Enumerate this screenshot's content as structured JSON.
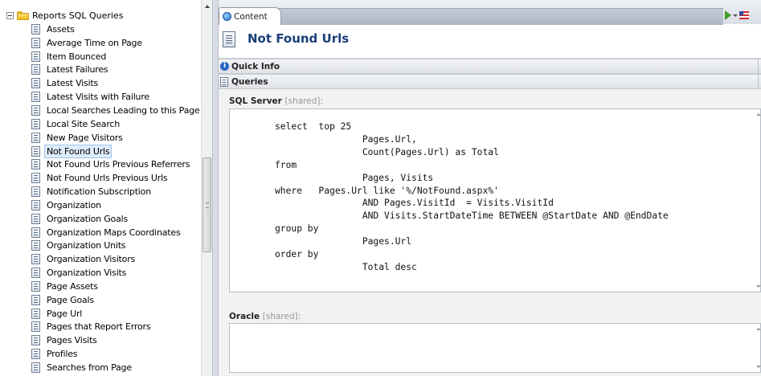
{
  "tree": {
    "root_label": "Reports SQL Queries",
    "items": [
      {
        "label": "Assets"
      },
      {
        "label": "Average Time on Page"
      },
      {
        "label": "Item Bounced"
      },
      {
        "label": "Latest Failures"
      },
      {
        "label": "Latest Visits"
      },
      {
        "label": "Latest Visits with Failure"
      },
      {
        "label": "Local Searches Leading to this Page"
      },
      {
        "label": "Local Site Search"
      },
      {
        "label": "New Page Visitors"
      },
      {
        "label": "Not Found Urls",
        "selected": true
      },
      {
        "label": "Not Found Urls Previous Referrers"
      },
      {
        "label": "Not Found Urls Previous Urls"
      },
      {
        "label": "Notification Subscription"
      },
      {
        "label": "Organization"
      },
      {
        "label": "Organization Goals"
      },
      {
        "label": "Organization Maps Coordinates"
      },
      {
        "label": "Organization Units"
      },
      {
        "label": "Organization Visitors"
      },
      {
        "label": "Organization Visits"
      },
      {
        "label": "Page Assets"
      },
      {
        "label": "Page Goals"
      },
      {
        "label": "Page Url"
      },
      {
        "label": "Pages that Report Errors"
      },
      {
        "label": "Pages Visits"
      },
      {
        "label": "Profiles"
      },
      {
        "label": "Searches from Page"
      }
    ]
  },
  "editor": {
    "tab_label": "Content",
    "item_title": "Not Found Urls",
    "sections": {
      "quick_info": "Quick Info",
      "queries": "Queries"
    },
    "fields": {
      "sql_label": "SQL Server",
      "sql_shared": "[shared]:",
      "sql_value": "select  top 25\n                Pages.Url,\n                Count(Pages.Url) as Total\nfrom\n                Pages, Visits\nwhere   Pages.Url like '%/NotFound.aspx%'\n                AND Pages.VisitId  = Visits.VisitId\n                AND Visits.StartDateTime BETWEEN @StartDate AND @EndDate\ngroup by\n                Pages.Url\norder by\n                Total desc",
      "oracle_label": "Oracle",
      "oracle_shared": "[shared]:",
      "oracle_value": ""
    }
  },
  "colors": {
    "title": "#1a3e7a",
    "selection": "#e0ecfb",
    "folder": "#f0b91a"
  }
}
